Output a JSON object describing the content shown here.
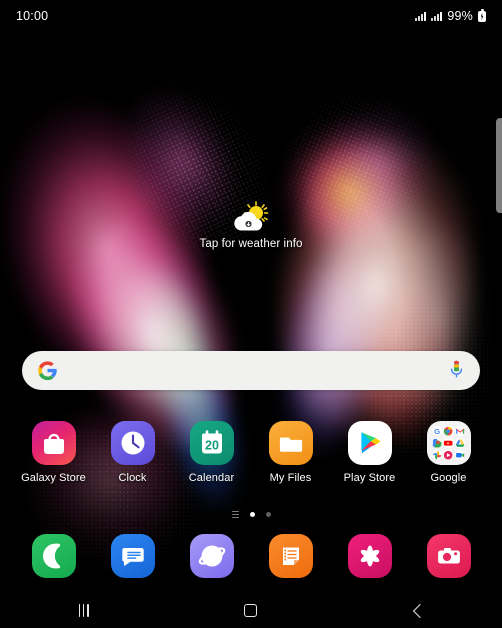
{
  "status_bar": {
    "time": "10:00",
    "battery_percent": "99%",
    "signal_icon": "signal-bars-icon",
    "signal_icon_2": "signal-bars-icon",
    "battery_icon": "battery-charging-icon"
  },
  "edge_panel": {
    "handle_name": "edge-panel-handle",
    "color": "#8a8a8a"
  },
  "weather_widget": {
    "text": "Tap for weather info",
    "icon": "sun-behind-cloud-icon",
    "sun_color": "#f9d71c",
    "cloud_color": "#ffffff"
  },
  "search_bar": {
    "google_logo": "google-g-logo",
    "mic_icon": "microphone-icon",
    "placeholder": "",
    "value": "",
    "background": "#f1f1ef"
  },
  "app_grid": [
    {
      "label": "Galaxy Store",
      "icon": "galaxy-store-icon",
      "color": "#e8257a"
    },
    {
      "label": "Clock",
      "icon": "clock-icon",
      "color": "#6b5ce7"
    },
    {
      "label": "Calendar",
      "icon": "calendar-icon",
      "color": "#0f9d7c",
      "day": "20"
    },
    {
      "label": "My Files",
      "icon": "my-files-icon",
      "color": "#f5a623"
    },
    {
      "label": "Play Store",
      "icon": "play-store-icon",
      "color": "#ffffff"
    },
    {
      "label": "Google",
      "icon": "google-folder-icon",
      "color": "#f3f3f3"
    }
  ],
  "google_folder": {
    "apps": [
      {
        "name": "google-search-icon",
        "glyph": "G",
        "color": "#ffffff"
      },
      {
        "name": "chrome-icon",
        "glyph": "",
        "color": "#ffffff"
      },
      {
        "name": "gmail-icon",
        "glyph": "M",
        "color": "#ffffff"
      },
      {
        "name": "maps-icon",
        "glyph": "",
        "color": "#ffffff"
      },
      {
        "name": "youtube-icon",
        "glyph": "",
        "color": "#ff0000"
      },
      {
        "name": "drive-icon",
        "glyph": "",
        "color": "#ffffff"
      },
      {
        "name": "photos-icon",
        "glyph": "",
        "color": "#e8453c"
      },
      {
        "name": "google-play-games-icon",
        "glyph": "",
        "color": "#ec407a"
      },
      {
        "name": "meet-icon",
        "glyph": "",
        "color": "#1a73e8"
      }
    ]
  },
  "page_indicator": {
    "pages": 3,
    "active_index": 1,
    "first_is_samsung_free": true
  },
  "dock": [
    {
      "label": "Phone",
      "icon": "phone-icon",
      "color": "#21b35a"
    },
    {
      "label": "Messages",
      "icon": "messages-icon",
      "color": "#1a73e8"
    },
    {
      "label": "Samsung Internet",
      "icon": "internet-icon",
      "color": "#8b7df0"
    },
    {
      "label": "Samsung Notes",
      "icon": "notes-icon",
      "color": "#f2760c"
    },
    {
      "label": "Gallery",
      "icon": "gallery-icon",
      "color": "#e0196e"
    },
    {
      "label": "Camera",
      "icon": "camera-icon",
      "color": "#e8285c"
    }
  ],
  "nav_bar": {
    "recents_label": "Recents",
    "home_label": "Home",
    "back_label": "Back",
    "recents_icon": "recents-icon",
    "home_icon": "home-icon",
    "back_icon": "back-chevron-icon"
  },
  "wallpaper": {
    "name": "galaxy-butterfly-wallpaper",
    "background": "#000000"
  }
}
